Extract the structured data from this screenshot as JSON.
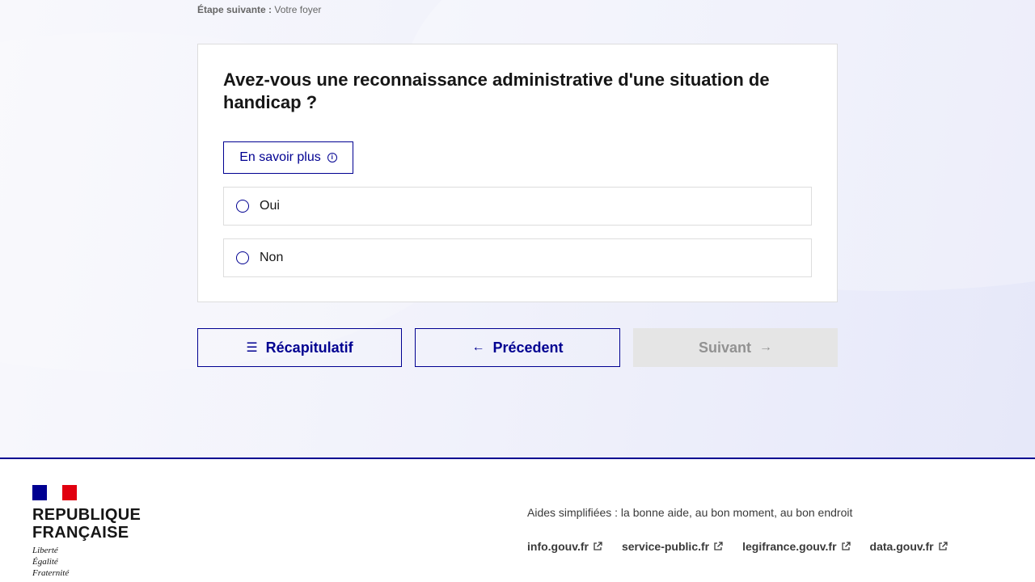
{
  "step": {
    "next_label": "Étape suivante :",
    "next_value": "Votre foyer"
  },
  "question": {
    "title": "Avez-vous une reconnaissance administrative d'une situation de handicap ?",
    "more_label": "En savoir plus",
    "options": [
      {
        "label": "Oui",
        "selected": false
      },
      {
        "label": "Non",
        "selected": false
      }
    ]
  },
  "navigation": {
    "recap_label": "Récapitulatif",
    "prev_label": "Précedent",
    "next_label": "Suivant",
    "next_disabled": true
  },
  "footer": {
    "brand_line1": "REPUBLIQUE",
    "brand_line2": "FRANÇAISE",
    "motto": [
      "Liberté",
      "Égalité",
      "Fraternité"
    ],
    "description": "Aides simplifiées : la bonne aide, au bon moment, au bon endroit",
    "links": [
      {
        "label": "info.gouv.fr"
      },
      {
        "label": "service-public.fr"
      },
      {
        "label": "legifrance.gouv.fr"
      },
      {
        "label": "data.gouv.fr"
      }
    ]
  },
  "colors": {
    "primary": "#000091",
    "disabled_bg": "#e5e5e5",
    "disabled_text": "#929292",
    "flag_red": "#e1000f"
  }
}
